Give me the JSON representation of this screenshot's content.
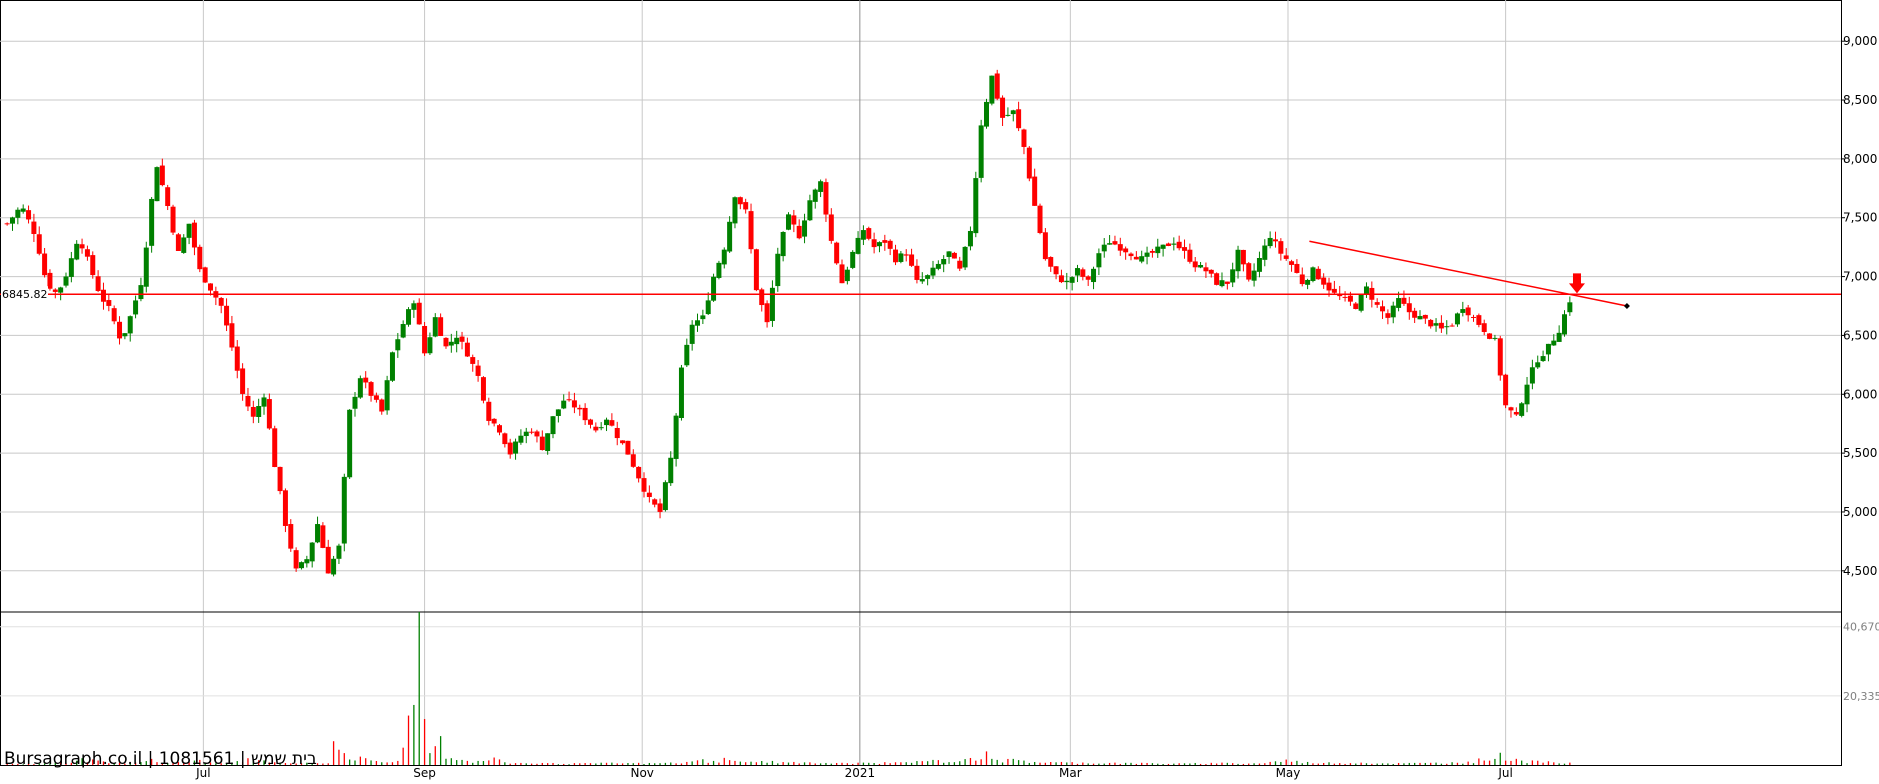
{
  "chart_data": [
    {
      "type": "candlestick",
      "title": "",
      "xlabel": "",
      "ylabel": "",
      "ylim": [
        4150,
        9350
      ],
      "y_ticks": [
        4500,
        5000,
        5500,
        6000,
        6500,
        7000,
        7500,
        8000,
        8500,
        9000
      ],
      "y_tick_labels": [
        "4,500",
        "5,000",
        "5,500",
        "6,000",
        "6,500",
        "7,000",
        "7,500",
        "8,000",
        "8,500",
        "9,000"
      ],
      "x_tick_labels": [
        "Jul",
        "Sep",
        "Nov",
        "2021",
        "Mar",
        "May",
        "Jul"
      ],
      "x_tick_days": [
        35,
        97,
        158,
        219,
        278,
        339,
        400
      ],
      "x_range_days": [
        -22,
        494
      ],
      "x_axis_note": "days since 2020-05-27",
      "grid": true,
      "up_color": "#008000",
      "down_color": "#ff0000",
      "price_points": [
        [
          -20,
          7450
        ],
        [
          -16,
          7600
        ],
        [
          -12,
          7350
        ],
        [
          -9,
          6950
        ],
        [
          -6,
          6850
        ],
        [
          -3,
          7050
        ],
        [
          0,
          7350
        ],
        [
          3,
          7100
        ],
        [
          6,
          6850
        ],
        [
          9,
          6700
        ],
        [
          12,
          6450
        ],
        [
          15,
          6700
        ],
        [
          18,
          7000
        ],
        [
          20,
          7550
        ],
        [
          22,
          7950
        ],
        [
          25,
          7600
        ],
        [
          28,
          7200
        ],
        [
          31,
          7450
        ],
        [
          34,
          7050
        ],
        [
          37,
          6900
        ],
        [
          40,
          6750
        ],
        [
          43,
          6400
        ],
        [
          46,
          6000
        ],
        [
          49,
          5800
        ],
        [
          52,
          6000
        ],
        [
          55,
          5400
        ],
        [
          58,
          4900
        ],
        [
          61,
          4500
        ],
        [
          64,
          4600
        ],
        [
          67,
          4900
        ],
        [
          70,
          4500
        ],
        [
          73,
          4700
        ],
        [
          76,
          5850
        ],
        [
          79,
          6150
        ],
        [
          82,
          6000
        ],
        [
          85,
          5850
        ],
        [
          88,
          6350
        ],
        [
          91,
          6600
        ],
        [
          94,
          6800
        ],
        [
          97,
          6350
        ],
        [
          100,
          6650
        ],
        [
          103,
          6400
        ],
        [
          106,
          6500
        ],
        [
          109,
          6350
        ],
        [
          112,
          6150
        ],
        [
          115,
          5800
        ],
        [
          118,
          5700
        ],
        [
          121,
          5500
        ],
        [
          124,
          5650
        ],
        [
          127,
          5700
        ],
        [
          130,
          5550
        ],
        [
          133,
          5800
        ],
        [
          136,
          5950
        ],
        [
          139,
          5900
        ],
        [
          142,
          5800
        ],
        [
          145,
          5700
        ],
        [
          148,
          5800
        ],
        [
          151,
          5650
        ],
        [
          154,
          5500
        ],
        [
          157,
          5300
        ],
        [
          160,
          5100
        ],
        [
          163,
          5000
        ],
        [
          166,
          5450
        ],
        [
          169,
          6200
        ],
        [
          172,
          6600
        ],
        [
          175,
          6650
        ],
        [
          178,
          7000
        ],
        [
          181,
          7250
        ],
        [
          184,
          7700
        ],
        [
          187,
          7550
        ],
        [
          190,
          6900
        ],
        [
          193,
          6600
        ],
        [
          196,
          7200
        ],
        [
          199,
          7500
        ],
        [
          202,
          7350
        ],
        [
          205,
          7650
        ],
        [
          208,
          7800
        ],
        [
          211,
          7300
        ],
        [
          214,
          6950
        ],
        [
          217,
          7200
        ],
        [
          220,
          7400
        ],
        [
          223,
          7250
        ],
        [
          226,
          7300
        ],
        [
          229,
          7150
        ],
        [
          232,
          7200
        ],
        [
          235,
          6950
        ],
        [
          238,
          7000
        ],
        [
          241,
          7100
        ],
        [
          244,
          7200
        ],
        [
          247,
          7050
        ],
        [
          250,
          7400
        ],
        [
          253,
          8300
        ],
        [
          256,
          8700
        ],
        [
          259,
          8350
        ],
        [
          262,
          8400
        ],
        [
          265,
          8100
        ],
        [
          268,
          7600
        ],
        [
          271,
          7150
        ],
        [
          274,
          7000
        ],
        [
          277,
          6950
        ],
        [
          280,
          7050
        ],
        [
          283,
          6950
        ],
        [
          286,
          7200
        ],
        [
          289,
          7300
        ],
        [
          292,
          7250
        ],
        [
          295,
          7200
        ],
        [
          298,
          7150
        ],
        [
          301,
          7200
        ],
        [
          304,
          7250
        ],
        [
          307,
          7300
        ],
        [
          310,
          7200
        ],
        [
          313,
          7100
        ],
        [
          316,
          7050
        ],
        [
          319,
          6950
        ],
        [
          322,
          6950
        ],
        [
          325,
          7200
        ],
        [
          328,
          6950
        ],
        [
          331,
          7150
        ],
        [
          334,
          7350
        ],
        [
          337,
          7200
        ],
        [
          340,
          7100
        ],
        [
          343,
          6950
        ],
        [
          346,
          7050
        ],
        [
          349,
          6950
        ],
        [
          352,
          6850
        ],
        [
          355,
          6800
        ],
        [
          358,
          6750
        ],
        [
          361,
          6900
        ],
        [
          364,
          6750
        ],
        [
          367,
          6650
        ],
        [
          370,
          6800
        ],
        [
          373,
          6700
        ],
        [
          376,
          6650
        ],
        [
          379,
          6600
        ],
        [
          382,
          6550
        ],
        [
          385,
          6600
        ],
        [
          388,
          6750
        ],
        [
          391,
          6650
        ],
        [
          394,
          6550
        ],
        [
          397,
          6450
        ],
        [
          400,
          5900
        ],
        [
          403,
          5800
        ],
        [
          406,
          6100
        ],
        [
          409,
          6300
        ],
        [
          412,
          6400
        ],
        [
          415,
          6550
        ],
        [
          418,
          6800
        ]
      ],
      "volume_ylim": [
        0,
        45000
      ],
      "volume_ticks": [
        20335,
        40670
      ],
      "volume_tick_labels": [
        "20,335",
        "40,670"
      ],
      "volume_points": [
        [
          -20,
          500
        ],
        [
          -10,
          400
        ],
        [
          1,
          2000
        ],
        [
          10,
          500
        ],
        [
          20,
          1800
        ],
        [
          25,
          600
        ],
        [
          34,
          1500
        ],
        [
          40,
          500
        ],
        [
          47,
          2000
        ],
        [
          55,
          800
        ],
        [
          70,
          500
        ],
        [
          72,
          7000
        ],
        [
          75,
          3500
        ],
        [
          80,
          2000
        ],
        [
          85,
          800
        ],
        [
          90,
          1200
        ],
        [
          95,
          45000
        ],
        [
          98,
          3500
        ],
        [
          101,
          8500
        ],
        [
          104,
          2000
        ],
        [
          108,
          1500
        ],
        [
          112,
          1200
        ],
        [
          116,
          2200
        ],
        [
          120,
          800
        ],
        [
          130,
          600
        ],
        [
          140,
          500
        ],
        [
          150,
          700
        ],
        [
          160,
          600
        ],
        [
          170,
          900
        ],
        [
          175,
          1700
        ],
        [
          178,
          1200
        ],
        [
          181,
          2100
        ],
        [
          185,
          1000
        ],
        [
          195,
          1200
        ],
        [
          200,
          900
        ],
        [
          210,
          600
        ],
        [
          220,
          700
        ],
        [
          230,
          800
        ],
        [
          240,
          1500
        ],
        [
          247,
          1100
        ],
        [
          255,
          4000
        ],
        [
          258,
          1500
        ],
        [
          262,
          1800
        ],
        [
          265,
          1300
        ],
        [
          275,
          900
        ],
        [
          290,
          700
        ],
        [
          300,
          600
        ],
        [
          310,
          500
        ],
        [
          320,
          700
        ],
        [
          330,
          500
        ],
        [
          338,
          1600
        ],
        [
          345,
          900
        ],
        [
          350,
          800
        ],
        [
          360,
          700
        ],
        [
          370,
          600
        ],
        [
          380,
          700
        ],
        [
          390,
          1000
        ],
        [
          398,
          3600
        ],
        [
          405,
          1300
        ],
        [
          412,
          1100
        ],
        [
          418,
          700
        ]
      ],
      "support_level": 6850,
      "support_label": "6845.82",
      "trendline": [
        [
          345,
          7300
        ],
        [
          434,
          6750
        ]
      ],
      "last_marker_y": 6750,
      "alert_marker": [
        420,
        6840
      ],
      "watermark": "Bursagraph.co.il | 1081561 | בית שמש"
    }
  ]
}
